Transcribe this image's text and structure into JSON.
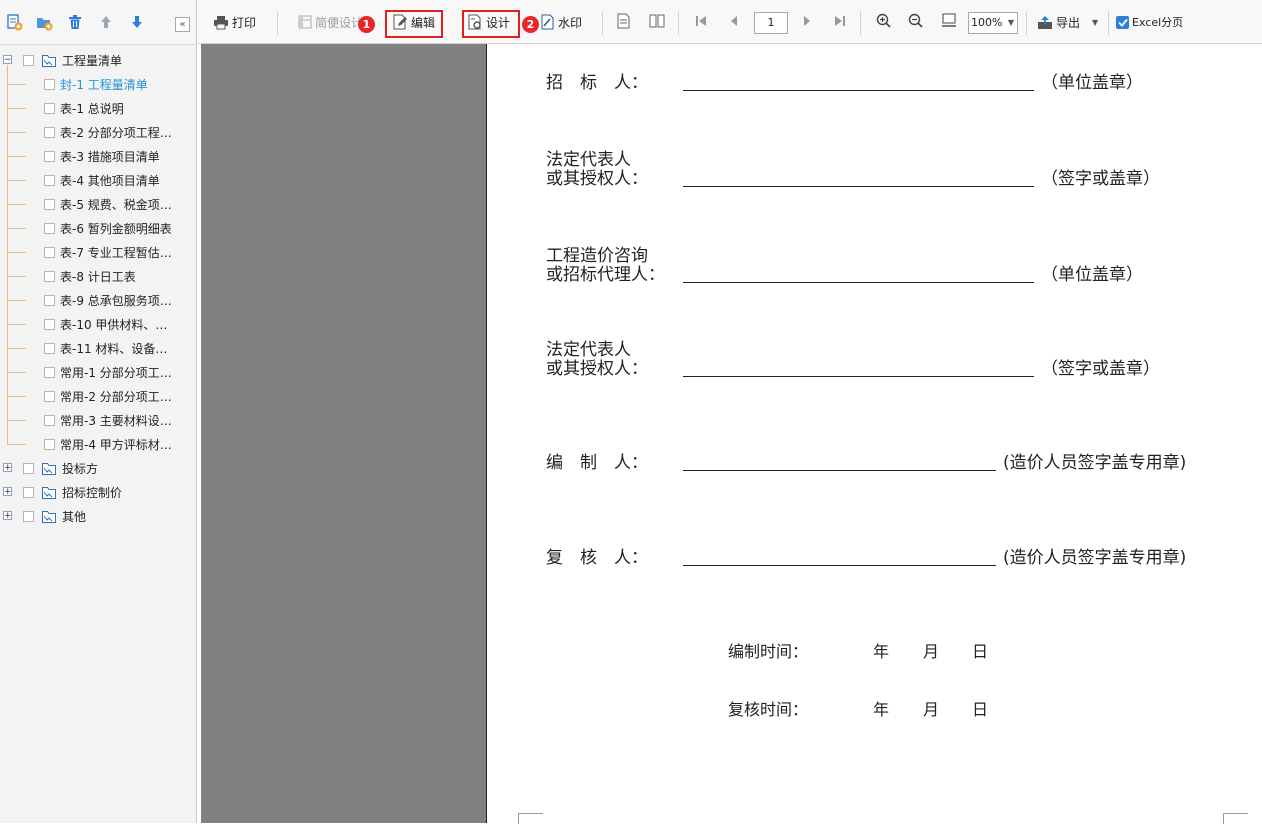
{
  "left_toolbar": {
    "icons": [
      "add-report-icon",
      "add-folder-icon",
      "delete-icon",
      "move-up-icon",
      "move-down-icon",
      "collapse-icon"
    ],
    "collapse_label": "«"
  },
  "tree": {
    "root": {
      "label": "工程量清单",
      "expander": "−"
    },
    "children": [
      {
        "label": "封-1 工程量清单",
        "selected": true
      },
      {
        "label": "表-1 总说明"
      },
      {
        "label": "表-2 分部分项工程…"
      },
      {
        "label": "表-3 措施项目清单"
      },
      {
        "label": "表-4 其他项目清单"
      },
      {
        "label": "表-5 规费、税金项…"
      },
      {
        "label": "表-6 暂列金额明细表"
      },
      {
        "label": "表-7 专业工程暂估…"
      },
      {
        "label": "表-8 计日工表"
      },
      {
        "label": "表-9 总承包服务项…"
      },
      {
        "label": "表-10 甲供材料、…"
      },
      {
        "label": "表-11 材料、设备…"
      },
      {
        "label": "常用-1 分部分项工…"
      },
      {
        "label": "常用-2 分部分项工…"
      },
      {
        "label": "常用-3 主要材料设…"
      },
      {
        "label": "常用-4 甲方评标材…"
      }
    ],
    "groups": [
      {
        "label": "投标方",
        "expander": "+"
      },
      {
        "label": "招标控制价",
        "expander": "+"
      },
      {
        "label": "其他",
        "expander": "+"
      }
    ]
  },
  "toolbar": {
    "print": "打印",
    "simple_design": "简便设计",
    "edit": "编辑",
    "design": "设计",
    "watermark": "水印",
    "page_number": "1",
    "zoom": "100%",
    "export": "导出",
    "excel_paging": "Excel分页",
    "step1": "1",
    "step2": "2"
  },
  "document": {
    "rows": [
      {
        "label_lines": [
          "招　标　人："
        ],
        "suffix": "（单位盖章）"
      },
      {
        "label_lines": [
          "法定代表人",
          "或其授权人："
        ],
        "suffix": "（签字或盖章）"
      },
      {
        "label_lines": [
          "工程造价咨询",
          "或招标代理人："
        ],
        "suffix": "（单位盖章）"
      },
      {
        "label_lines": [
          "法定代表人",
          "或其授权人："
        ],
        "suffix": "（签字或盖章）"
      },
      {
        "label_lines": [
          "编　制　人："
        ],
        "suffix": "(造价人员签字盖专用章)"
      },
      {
        "label_lines": [
          "复　核　人："
        ],
        "suffix": "(造价人员签字盖专用章)"
      }
    ],
    "compile_time": "编制时间：",
    "review_time": "复核时间：",
    "year": "年",
    "month": "月",
    "day": "日"
  },
  "colors": {
    "highlight": "#e02020",
    "selected_text": "#1f95d6",
    "viewer_gray": "#808080",
    "tree_line": "#f0b97c"
  }
}
